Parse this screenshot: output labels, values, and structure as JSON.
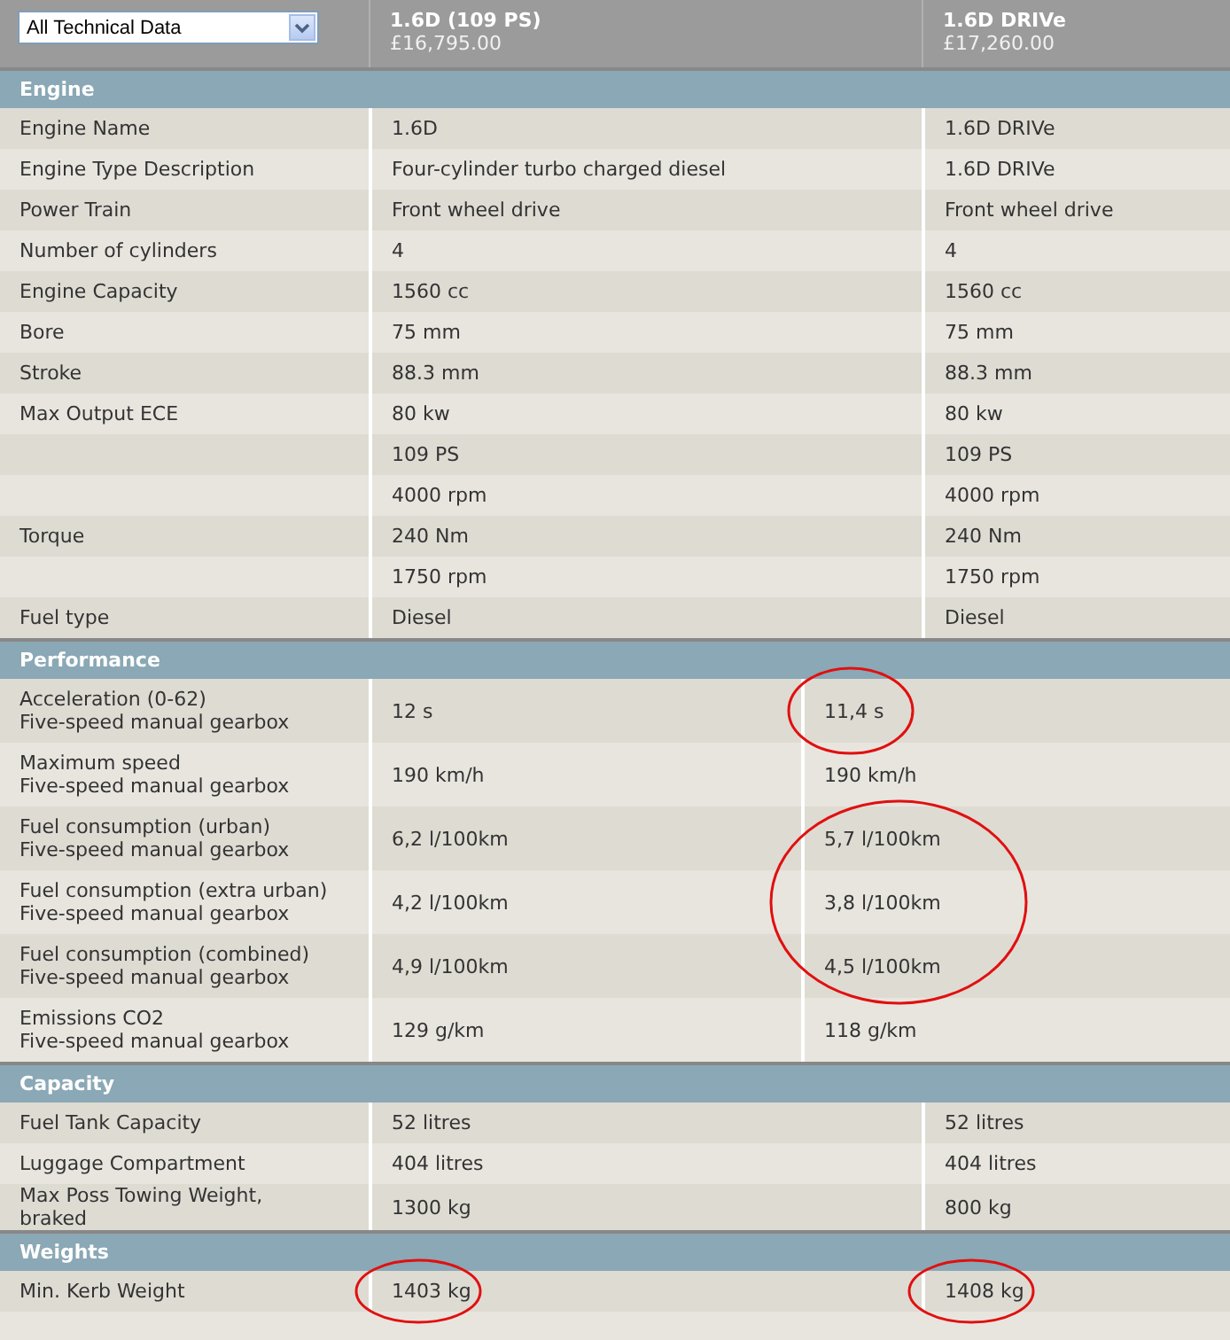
{
  "selector": {
    "value": "All Technical Data"
  },
  "models": [
    {
      "name": "1.6D (109 PS)",
      "price": "£16,795.00"
    },
    {
      "name": "1.6D DRIVe",
      "price": "£17,260.00"
    }
  ],
  "sections": [
    {
      "title": "Engine",
      "kind": "simple",
      "rows": [
        {
          "label": "Engine Name",
          "values": [
            "1.6D",
            "1.6D DRIVe"
          ]
        },
        {
          "label": "Engine Type Description",
          "values": [
            "Four-cylinder turbo charged diesel",
            "1.6D DRIVe"
          ]
        },
        {
          "label": "Power Train",
          "values": [
            "Front wheel drive",
            "Front wheel drive"
          ]
        },
        {
          "label": "Number of cylinders",
          "values": [
            "4",
            "4"
          ]
        },
        {
          "label": "Engine Capacity",
          "values": [
            "1560 cc",
            "1560 cc"
          ]
        },
        {
          "label": "Bore",
          "values": [
            "75 mm",
            "75 mm"
          ]
        },
        {
          "label": "Stroke",
          "values": [
            "88.3 mm",
            "88.3 mm"
          ]
        },
        {
          "label": "Max Output ECE",
          "values": [
            "80 kw",
            "80 kw"
          ]
        },
        {
          "values": [
            "109 PS",
            "109 PS"
          ]
        },
        {
          "values": [
            "4000 rpm",
            "4000 rpm"
          ]
        },
        {
          "label": "Torque",
          "values": [
            "240 Nm",
            "240 Nm"
          ]
        },
        {
          "values": [
            "1750 rpm",
            "1750 rpm"
          ]
        },
        {
          "label": "Fuel type",
          "values": [
            "Diesel",
            "Diesel"
          ]
        }
      ]
    },
    {
      "title": "Performance",
      "kind": "gearbox",
      "rows": [
        {
          "label": "Acceleration (0-62)",
          "note": "Five-speed manual gearbox",
          "values": [
            "12 s",
            "11,4 s"
          ],
          "circled": [
            false,
            true
          ]
        },
        {
          "label": "Maximum speed",
          "note": "Five-speed manual gearbox",
          "values": [
            "190 km/h",
            "190 km/h"
          ]
        },
        {
          "label": "Fuel consumption (urban)",
          "note": "Five-speed manual gearbox",
          "values": [
            "6,2 l/100km",
            "5,7 l/100km"
          ],
          "circled": [
            false,
            true
          ]
        },
        {
          "label": "Fuel consumption (extra urban)",
          "note": "Five-speed manual gearbox",
          "values": [
            "4,2 l/100km",
            "3,8 l/100km"
          ],
          "circled": [
            false,
            true
          ]
        },
        {
          "label": "Fuel consumption (combined)",
          "note": "Five-speed manual gearbox",
          "values": [
            "4,9 l/100km",
            "4,5 l/100km"
          ],
          "circled": [
            false,
            true
          ]
        },
        {
          "label": "Emissions CO2",
          "note": "Five-speed manual gearbox",
          "values": [
            "129 g/km",
            "118 g/km"
          ]
        }
      ]
    },
    {
      "title": "Capacity",
      "kind": "simple",
      "rows": [
        {
          "label": "Fuel Tank Capacity",
          "values": [
            "52 litres",
            "52 litres"
          ]
        },
        {
          "label": "Luggage Compartment",
          "values": [
            "404 litres",
            "404 litres"
          ]
        },
        {
          "label": "Max Poss Towing Weight, braked",
          "values": [
            "1300 kg",
            "800 kg"
          ]
        }
      ]
    },
    {
      "title": "Weights",
      "kind": "simple",
      "rows": [
        {
          "label": "Min. Kerb Weight",
          "values": [
            "1403 kg",
            "1408 kg"
          ],
          "circled": [
            true,
            true
          ]
        }
      ]
    }
  ]
}
